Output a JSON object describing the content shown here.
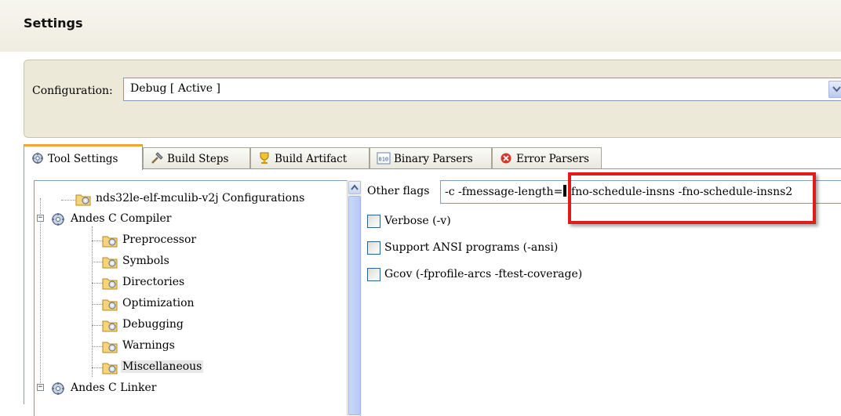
{
  "header": {
    "title": "Settings"
  },
  "configuration": {
    "label": "Configuration:",
    "value": "Debug  [ Active ]",
    "edge_button_label": "]"
  },
  "tabs": [
    {
      "label": "Tool Settings",
      "icon": "gear-icon",
      "active": true
    },
    {
      "label": "Build Steps",
      "icon": "hammer-icon",
      "active": false
    },
    {
      "label": "Build Artifact",
      "icon": "trophy-icon",
      "active": false
    },
    {
      "label": "Binary Parsers",
      "icon": "binary-icon",
      "active": false
    },
    {
      "label": "Error Parsers",
      "icon": "error-icon",
      "active": false
    }
  ],
  "tree": {
    "items": [
      {
        "label": "nds32le-elf-mculib-v2j Configurations",
        "icon": "folder-gear-icon"
      },
      {
        "label": "Andes C Compiler",
        "icon": "gear-icon",
        "expander": "−"
      },
      {
        "label": "Preprocessor",
        "icon": "folder-gear-icon"
      },
      {
        "label": "Symbols",
        "icon": "folder-gear-icon"
      },
      {
        "label": "Directories",
        "icon": "folder-gear-icon"
      },
      {
        "label": "Optimization",
        "icon": "folder-gear-icon"
      },
      {
        "label": "Debugging",
        "icon": "folder-gear-icon"
      },
      {
        "label": "Warnings",
        "icon": "folder-gear-icon"
      },
      {
        "label": "Miscellaneous",
        "icon": "folder-gear-icon",
        "selected": true
      },
      {
        "label": "Andes C Linker",
        "icon": "gear-icon",
        "expander": "−"
      }
    ]
  },
  "options": {
    "other_flags_label": "Other flags",
    "other_flags_before_caret": "-c -fmessage-length=",
    "other_flags_after_caret": "-fno-schedule-insns -fno-schedule-insns2",
    "checkboxes": [
      {
        "label": "Verbose (-v)",
        "checked": false
      },
      {
        "label": "Support ANSI programs (-ansi)",
        "checked": false
      },
      {
        "label": "Gcov (-fprofile-arcs -ftest-coverage)",
        "checked": false
      }
    ]
  },
  "colors": {
    "highlight": "#e01b1b",
    "active_tab_accent": "#f1a736",
    "panel_bg": "#ece9d8"
  }
}
